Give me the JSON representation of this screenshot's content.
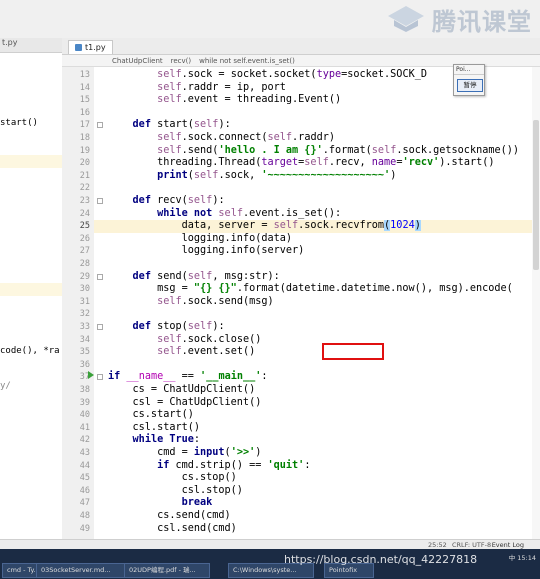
{
  "watermark": {
    "text": "腾讯课堂",
    "icon": "tencent-classroom-logo-icon"
  },
  "left_panel": {
    "header": "t.py",
    "snippets": [
      {
        "text": "start()",
        "row": 9
      },
      {
        "text": "code(), *ra",
        "row": 22
      },
      {
        "text": "y/",
        "row": 26
      }
    ]
  },
  "tab": {
    "label": "t1.py"
  },
  "breadcrumb": {
    "items": [
      "ChatUdpClient",
      "recv()",
      "while not self.event.is_set()"
    ]
  },
  "popup": {
    "title": "Poi...",
    "button": "暂停"
  },
  "code": {
    "lines": [
      {
        "n": "13",
        "html": "        <span class='self'>self</span>.sock = socket.socket(<span class='par'>type</span>=socket.SOCK_D"
      },
      {
        "n": "14",
        "html": "        <span class='self'>self</span>.raddr = ip, port"
      },
      {
        "n": "15",
        "html": "        <span class='self'>self</span>.event = threading.Event()"
      },
      {
        "n": "16",
        "html": ""
      },
      {
        "n": "17",
        "html": "    <span class='kw'>def</span> start(<span class='self'>self</span>):"
      },
      {
        "n": "18",
        "html": "        <span class='self'>self</span>.sock.connect(<span class='self'>self</span>.raddr)"
      },
      {
        "n": "19",
        "html": "        <span class='self'>self</span>.send(<span class='str'>'hello . I am {}'</span>.format(<span class='self'>self</span>.sock.getsockname())"
      },
      {
        "n": "20",
        "html": "        threading.Thread(<span class='par'>target</span>=<span class='self'>self</span>.recv, <span class='par'>name</span>=<span class='str'>'recv'</span>).start()"
      },
      {
        "n": "21",
        "html": "        <span class='kw'>print</span>(<span class='self'>self</span>.sock, <span class='str'>'~~~~~~~~~~~~~~~~~~~'</span>)"
      },
      {
        "n": "22",
        "html": ""
      },
      {
        "n": "23",
        "html": "    <span class='kw'>def</span> recv(<span class='self'>self</span>):"
      },
      {
        "n": "24",
        "html": "        <span class='kw'>while not</span> <span class='self'>self</span>.event.is_set():"
      },
      {
        "n": "25",
        "html": "            data, server = <span class='self'>self</span>.sock.recvfrom<span class='hlparen'>(</span><span class='num'>1024</span><span class='hlparen'>)</span>",
        "hl": true
      },
      {
        "n": "26",
        "html": "            logging.info(data)"
      },
      {
        "n": "27",
        "html": "            logging.info(server)"
      },
      {
        "n": "28",
        "html": ""
      },
      {
        "n": "29",
        "html": "    <span class='kw'>def</span> send(<span class='self'>self</span>, msg:str):"
      },
      {
        "n": "30",
        "html": "        msg = <span class='str'>\"{} {}\"</span>.format(datetime.datetime.now(), msg).encode("
      },
      {
        "n": "31",
        "html": "        <span class='self'>self</span>.sock.send(msg)"
      },
      {
        "n": "32",
        "html": ""
      },
      {
        "n": "33",
        "html": "    <span class='kw'>def</span> stop(<span class='self'>self</span>):"
      },
      {
        "n": "34",
        "html": "        <span class='self'>self</span>.sock.close()"
      },
      {
        "n": "35",
        "html": "        <span class='self'>self</span>.event.set()"
      },
      {
        "n": "36",
        "html": ""
      },
      {
        "n": "37",
        "html": "<span class='kw'>if</span> <span class='dund'>__name__</span> == <span class='str'>'__main__'</span>:"
      },
      {
        "n": "38",
        "html": "    cs = ChatUdpClient()"
      },
      {
        "n": "39",
        "html": "    csl = ChatUdpClient()"
      },
      {
        "n": "40",
        "html": "    cs.start()"
      },
      {
        "n": "41",
        "html": "    csl.start()"
      },
      {
        "n": "42",
        "html": "    <span class='kw'>while True</span>:"
      },
      {
        "n": "43",
        "html": "        cmd = <span class='kw'>input</span>(<span class='str'>'>>'</span>)"
      },
      {
        "n": "44",
        "html": "        <span class='kw'>if</span> cmd.strip() == <span class='str'>'quit'</span>:"
      },
      {
        "n": "45",
        "html": "            cs.stop()"
      },
      {
        "n": "46",
        "html": "            csl.stop()"
      },
      {
        "n": "47",
        "html": "            <span class='kw'>break</span>"
      },
      {
        "n": "48",
        "html": "        cs.send(cmd)"
      },
      {
        "n": "49",
        "html": "        csl.send(cmd)"
      }
    ]
  },
  "status": {
    "position": "25:52",
    "encoding": "CRLF: UTF-8",
    "event_log": "Event Log"
  },
  "taskbar": {
    "items": [
      "cmd - Ty...",
      "03SocketServer.md...",
      "02UDP编程.pdf - 瑞...",
      "C:\\Windows\\syste...",
      "Pointofix"
    ],
    "csdn": "https://blog.csdn.net/qq_42227818",
    "ime": "中",
    "time": "15:14"
  }
}
